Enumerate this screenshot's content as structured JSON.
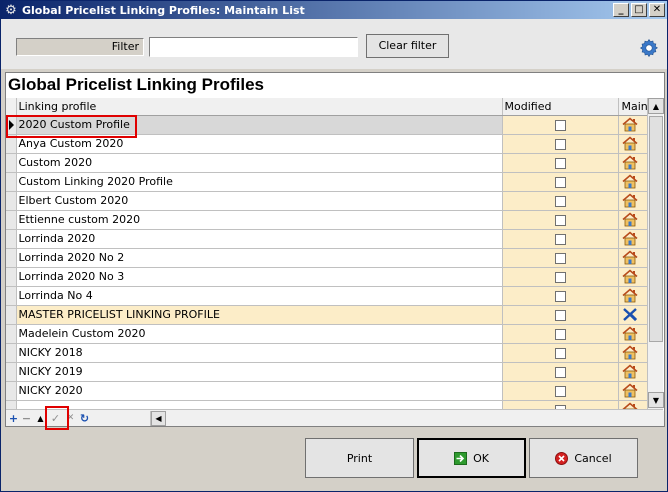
{
  "window": {
    "title": "Global Pricelist Linking Profiles: Maintain List",
    "minimize": "_",
    "maximize": "□",
    "close": "✕"
  },
  "filter": {
    "label": "Filter",
    "value": "",
    "clear_label": "Clear filter"
  },
  "heading": "Global Pricelist Linking Profiles",
  "columns": {
    "name": "Linking profile",
    "modified": "Modified",
    "maint": "Maint"
  },
  "rows": [
    {
      "name": "2020 Custom Profile",
      "selected": true,
      "icon": "house-icon"
    },
    {
      "name": "Anya Custom 2020",
      "icon": "house-icon"
    },
    {
      "name": "Custom 2020",
      "icon": "house-icon"
    },
    {
      "name": "Custom Linking 2020 Profile",
      "icon": "house-icon"
    },
    {
      "name": "Elbert Custom 2020",
      "icon": "house-icon"
    },
    {
      "name": "Ettienne custom 2020",
      "icon": "house-icon"
    },
    {
      "name": "Lorrinda 2020",
      "icon": "house-icon"
    },
    {
      "name": "Lorrinda 2020 No 2",
      "icon": "house-icon"
    },
    {
      "name": "Lorrinda 2020 No 3",
      "icon": "house-icon"
    },
    {
      "name": "Lorrinda No 4",
      "icon": "house-icon"
    },
    {
      "name": "MASTER PRICELIST LINKING PROFILE",
      "master": true,
      "icon": "blue-x-icon"
    },
    {
      "name": "Madelein Custom 2020",
      "icon": "house-icon"
    },
    {
      "name": "NICKY 2018",
      "icon": "house-icon"
    },
    {
      "name": "NICKY 2019",
      "icon": "house-icon"
    },
    {
      "name": "NICKY 2020",
      "icon": "house-icon"
    },
    {
      "name": "",
      "icon": "house-icon"
    }
  ],
  "navigator": {
    "add": "+",
    "remove": "−",
    "up": "▲",
    "post": "✓",
    "cancel": "✕",
    "refresh": "↻"
  },
  "footer": {
    "print_label": "Print",
    "ok_label": "OK",
    "cancel_label": "Cancel"
  },
  "colors": {
    "titlebar_start": "#0a246a",
    "titlebar_end": "#a6caf0",
    "editable_column": "#fcedc8",
    "highlight": "#e00000",
    "ok_green": "#2e9a2e",
    "cancel_red": "#d42020"
  }
}
